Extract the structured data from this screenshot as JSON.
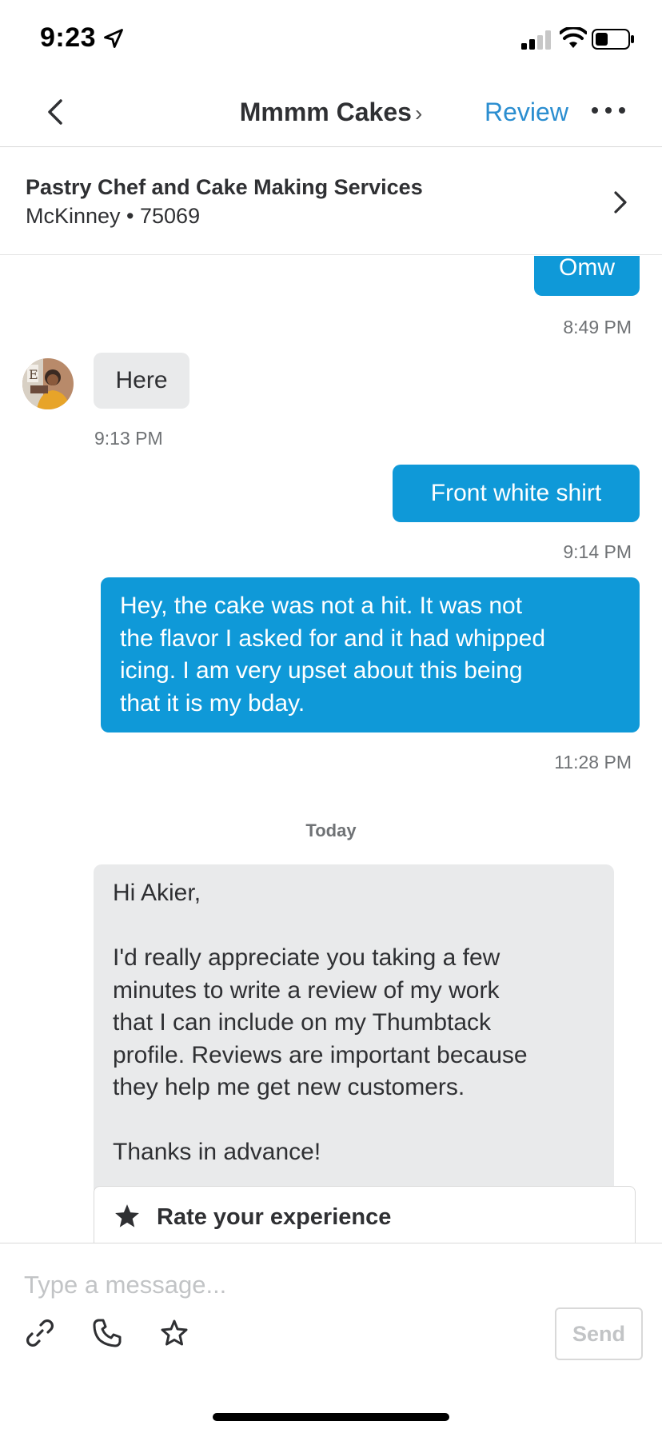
{
  "status_bar": {
    "time": "9:23"
  },
  "header": {
    "title": "Mmmm Cakes",
    "title_chevron": "›",
    "review_label": "Review"
  },
  "service": {
    "title": "Pastry Chef and Cake Making Services",
    "location": "McKinney • 75069"
  },
  "messages": [
    {
      "direction": "outgoing",
      "text": "Omw",
      "time": "8:49 PM"
    },
    {
      "direction": "incoming",
      "text": "Here",
      "time": "9:13 PM"
    },
    {
      "direction": "outgoing",
      "text": "Front white shirt",
      "time": "9:14 PM"
    },
    {
      "direction": "outgoing",
      "text": "Hey, the cake was not a hit. It was not\nthe flavor I asked for and it had whipped\nicing. I am very upset about this being\nthat it is my bday.",
      "time": "11:28 PM"
    }
  ],
  "day_separator": "Today",
  "review_request": {
    "text": "Hi Akier,\n\nI'd really appreciate you taking a few\nminutes to write a review of my work\nthat I can include on my Thumbtack\nprofile. Reviews are important because\nthey help me get new customers.\n\nThanks in advance!",
    "action_label": "Rate your experience"
  },
  "composer": {
    "placeholder": "Type a message...",
    "send_label": "Send"
  },
  "colors": {
    "accent": "#0f99d8",
    "link": "#2b8ed0",
    "incoming_bubble": "#e9eaeb"
  },
  "icons": [
    "location-arrow-icon",
    "signal-icon",
    "wifi-icon",
    "battery-icon",
    "back-chevron-icon",
    "more-icon",
    "chevron-right-icon",
    "star-filled-icon",
    "attachment-icon",
    "phone-icon",
    "star-outline-icon"
  ]
}
